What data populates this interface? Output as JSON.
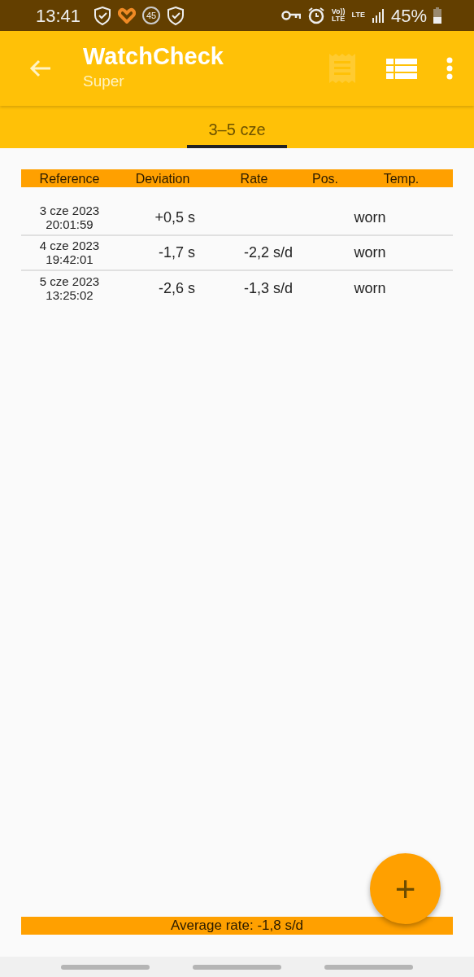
{
  "status_bar": {
    "time": "13:41",
    "badge": "45",
    "volte": [
      "Vo))",
      "LTE"
    ],
    "network": "LTE",
    "battery": "45%"
  },
  "app_bar": {
    "title": "WatchCheck",
    "subtitle": "Super",
    "actions": [
      {
        "kind": "receipt",
        "disabled": true
      },
      {
        "kind": "list",
        "disabled": false
      },
      {
        "kind": "more",
        "disabled": false
      }
    ]
  },
  "tabs": [
    {
      "label": "3–5 cze",
      "selected": true
    }
  ],
  "table": {
    "columns": [
      "Reference",
      "Deviation",
      "Rate",
      "Pos.",
      "Temp."
    ],
    "rows": [
      {
        "date": "3 cze 2023",
        "time": "20:01:59",
        "deviation": "+0,5 s",
        "position": "worn"
      },
      {
        "date": "4 cze 2023",
        "time": "19:42:01",
        "deviation": "-1,7 s",
        "rate": "-2,2 s/d",
        "position": "worn"
      },
      {
        "date": "5 cze 2023",
        "time": "13:25:02",
        "deviation": "-2,6 s",
        "rate": "-1,3 s/d",
        "position": "worn"
      }
    ]
  },
  "footer": {
    "average": "Average rate: -1,8 s/d"
  },
  "fab": {
    "label": "+"
  }
}
